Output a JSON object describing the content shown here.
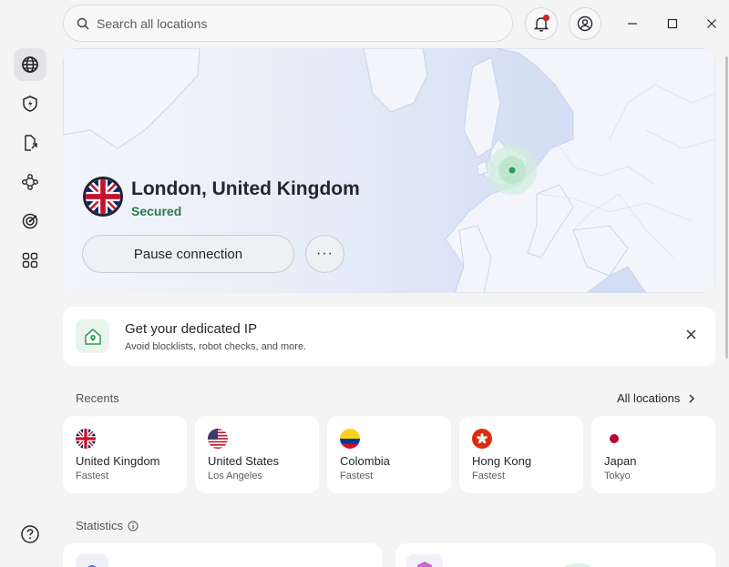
{
  "search": {
    "placeholder": "Search all locations"
  },
  "sidebar": {
    "items": [
      {
        "icon": "globe-icon",
        "active": true
      },
      {
        "icon": "shield-bolt-icon",
        "active": false
      },
      {
        "icon": "file-share-icon",
        "active": false
      },
      {
        "icon": "meshnet-icon",
        "active": false
      },
      {
        "icon": "radar-icon",
        "active": false
      },
      {
        "icon": "apps-grid-icon",
        "active": false
      }
    ],
    "help_icon": "help-icon"
  },
  "connection": {
    "location": "London, United Kingdom",
    "status": "Secured",
    "pause_label": "Pause connection",
    "more_label": "···"
  },
  "promo": {
    "title": "Get your dedicated IP",
    "subtitle": "Avoid blocklists, robot checks, and more."
  },
  "recents": {
    "label": "Recents",
    "all_locations_label": "All locations",
    "items": [
      {
        "name": "United Kingdom",
        "sub": "Fastest",
        "flag": "uk"
      },
      {
        "name": "United States",
        "sub": "Los Angeles",
        "flag": "us"
      },
      {
        "name": "Colombia",
        "sub": "Fastest",
        "flag": "co"
      },
      {
        "name": "Hong Kong",
        "sub": "Fastest",
        "flag": "hk"
      },
      {
        "name": "Japan",
        "sub": "Tokyo",
        "flag": "jp"
      }
    ]
  },
  "statistics": {
    "label": "Statistics"
  },
  "colors": {
    "secured": "#2d7a47",
    "notification_dot": "#d11f2d",
    "background": "#f4f4f5",
    "card": "#ffffff"
  }
}
